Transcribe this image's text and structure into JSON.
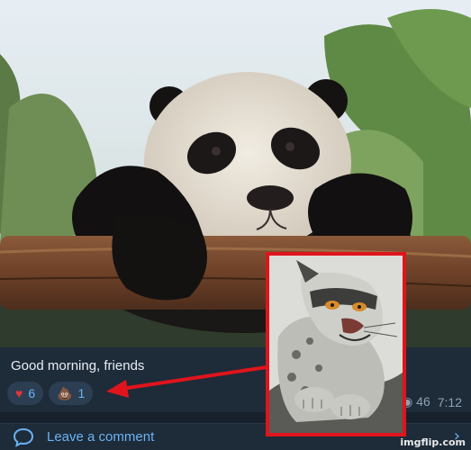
{
  "post": {
    "caption": "Good morning, friends",
    "reactions": [
      {
        "emoji": "♥",
        "icon": "heart-icon",
        "count": "6"
      },
      {
        "emoji": "💩",
        "icon": "poop-icon",
        "count": "1"
      }
    ],
    "views": "46",
    "time": "7:12"
  },
  "comment_bar": {
    "label": "Leave a comment",
    "chevron": "›"
  },
  "watermark": "imgflip.com",
  "colors": {
    "accent": "#6ab3f3",
    "highlight": "#e0141c",
    "background": "#1e2b39"
  }
}
